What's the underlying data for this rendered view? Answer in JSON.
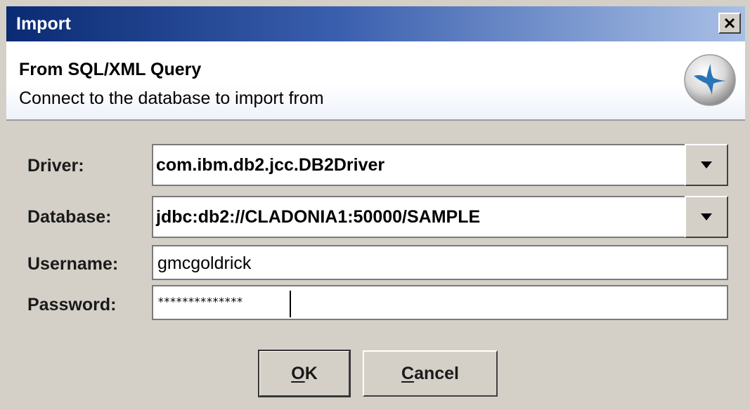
{
  "window": {
    "title": "Import"
  },
  "banner": {
    "title": "From SQL/XML Query",
    "subtitle": "Connect to the database to import from",
    "icon": "wizard-icon"
  },
  "form": {
    "driver_label": "Driver:",
    "driver_value": "com.ibm.db2.jcc.DB2Driver",
    "database_label": "Database:",
    "database_value": "jdbc:db2://CLADONIA1:50000/SAMPLE",
    "username_label": "Username:",
    "username_value": "gmcgoldrick",
    "password_label": "Password:",
    "password_value": "**************"
  },
  "buttons": {
    "ok_mnemonic": "O",
    "ok_rest": "K",
    "cancel_mnemonic": "C",
    "cancel_rest": "ancel"
  },
  "colors": {
    "title_start": "#0a2a73",
    "title_end": "#a9c0e6",
    "dialog_bg": "#d4d0c8"
  }
}
